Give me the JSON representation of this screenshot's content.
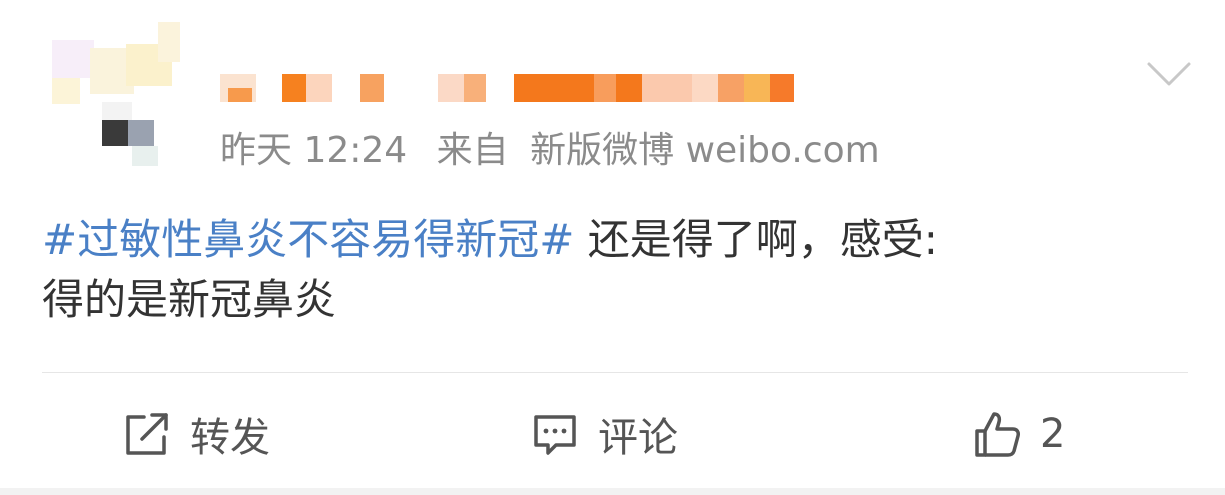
{
  "post": {
    "time": "昨天 12:24",
    "source_prefix": "来自",
    "source": "新版微博 weibo.com",
    "topic": "#过敏性鼻炎不容易得新冠#",
    "text_line1": " 还是得了啊，感受:",
    "text_line2": "得的是新冠鼻炎"
  },
  "actions": {
    "repost_label": "转发",
    "comment_label": "评论",
    "like_count": "2"
  },
  "colors": {
    "topic": "#4a80c6",
    "meta": "#8b8b8b",
    "text": "#333333",
    "icon": "#555555"
  },
  "icons": [
    "chevron-down-icon",
    "repost-icon",
    "comment-icon",
    "like-icon"
  ]
}
